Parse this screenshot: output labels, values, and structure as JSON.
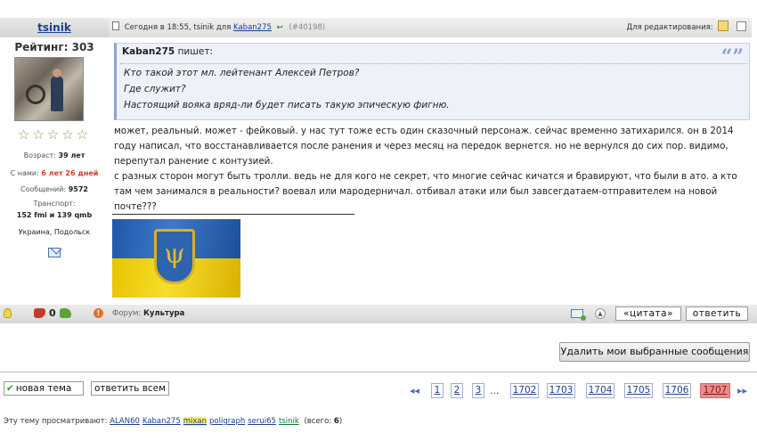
{
  "user": {
    "name": "tsinik",
    "rating_label": "Рейтинг:",
    "rating_value": "303",
    "stars": "☆☆☆☆☆",
    "age_label": "Возраст:",
    "age_value": "39 лет",
    "joined_label": "С нами:",
    "joined_value": "6 лет 26 дней",
    "messages_label": "Сообщений:",
    "messages_value": "9572",
    "transport_label": "Транспорт:",
    "transport_value": "152 fmi и 139 qmb",
    "location": "Украина, Подольск"
  },
  "post": {
    "date": "Сегодня в 18:55,",
    "author": "tsinik",
    "for_label": "для",
    "recipient": "Kaban275",
    "number": "(#40198)",
    "edit_label": "Для редактирования:",
    "quote": {
      "author": "Kaban275",
      "says": "пишет:",
      "lines": [
        "Кто такой этот мл. лейтенант Алексей Петров?",
        "Где служит?",
        "Настоящий вояка вряд-ли будет писать такую эпическую фигню."
      ]
    },
    "lines": [
      "может, реальный. может - фейковый. у нас тут тоже есть один сказочный персонаж. сейчас временно затихарился. он в 2014",
      "году написал, что восстанавливается после ранения и через месяц на передок вернется. но не вернулся до сих пор. видимо,",
      "перепутал ранение с контузией.",
      "с разных сторон могут быть тролли. ведь не для кого не секрет, что многие сейчас кичатся и бравируют, что были  в ато. а кто",
      "там чем занимался в реальности? воевал или мародерничал. отбивал атаки или был завсегдатаем-отправителем на новой",
      "почте???"
    ]
  },
  "footer": {
    "vote_count": "0",
    "forum_label": "Форум:",
    "forum_name": "Культура",
    "quote_button": "«цитата»",
    "reply_button": "ответить"
  },
  "delete_button": "Удалить мои выбранные сообщения",
  "bottom": {
    "new_topic": "новая тема",
    "reply_all": "ответить всем",
    "pages": [
      "1",
      "2",
      "3",
      "1702",
      "1703",
      "1704",
      "1705",
      "1706",
      "1707"
    ],
    "ellipsis": "...",
    "current_page": "1707"
  },
  "viewers": {
    "label": "Эту тему просматривают:",
    "users": [
      "ALAN60",
      "Kaban275",
      "mixan",
      "poligraph",
      "serui65",
      "tsinik"
    ],
    "highlighted_user": "mixan",
    "total_label": "(всего:",
    "total_value": "6",
    "total_close": ")"
  },
  "colors": {
    "current_page_bg": "#ef8a8a",
    "quote_bg": "#eef2f8",
    "link": "#1a3f8f",
    "highlight": "#fff25a"
  }
}
